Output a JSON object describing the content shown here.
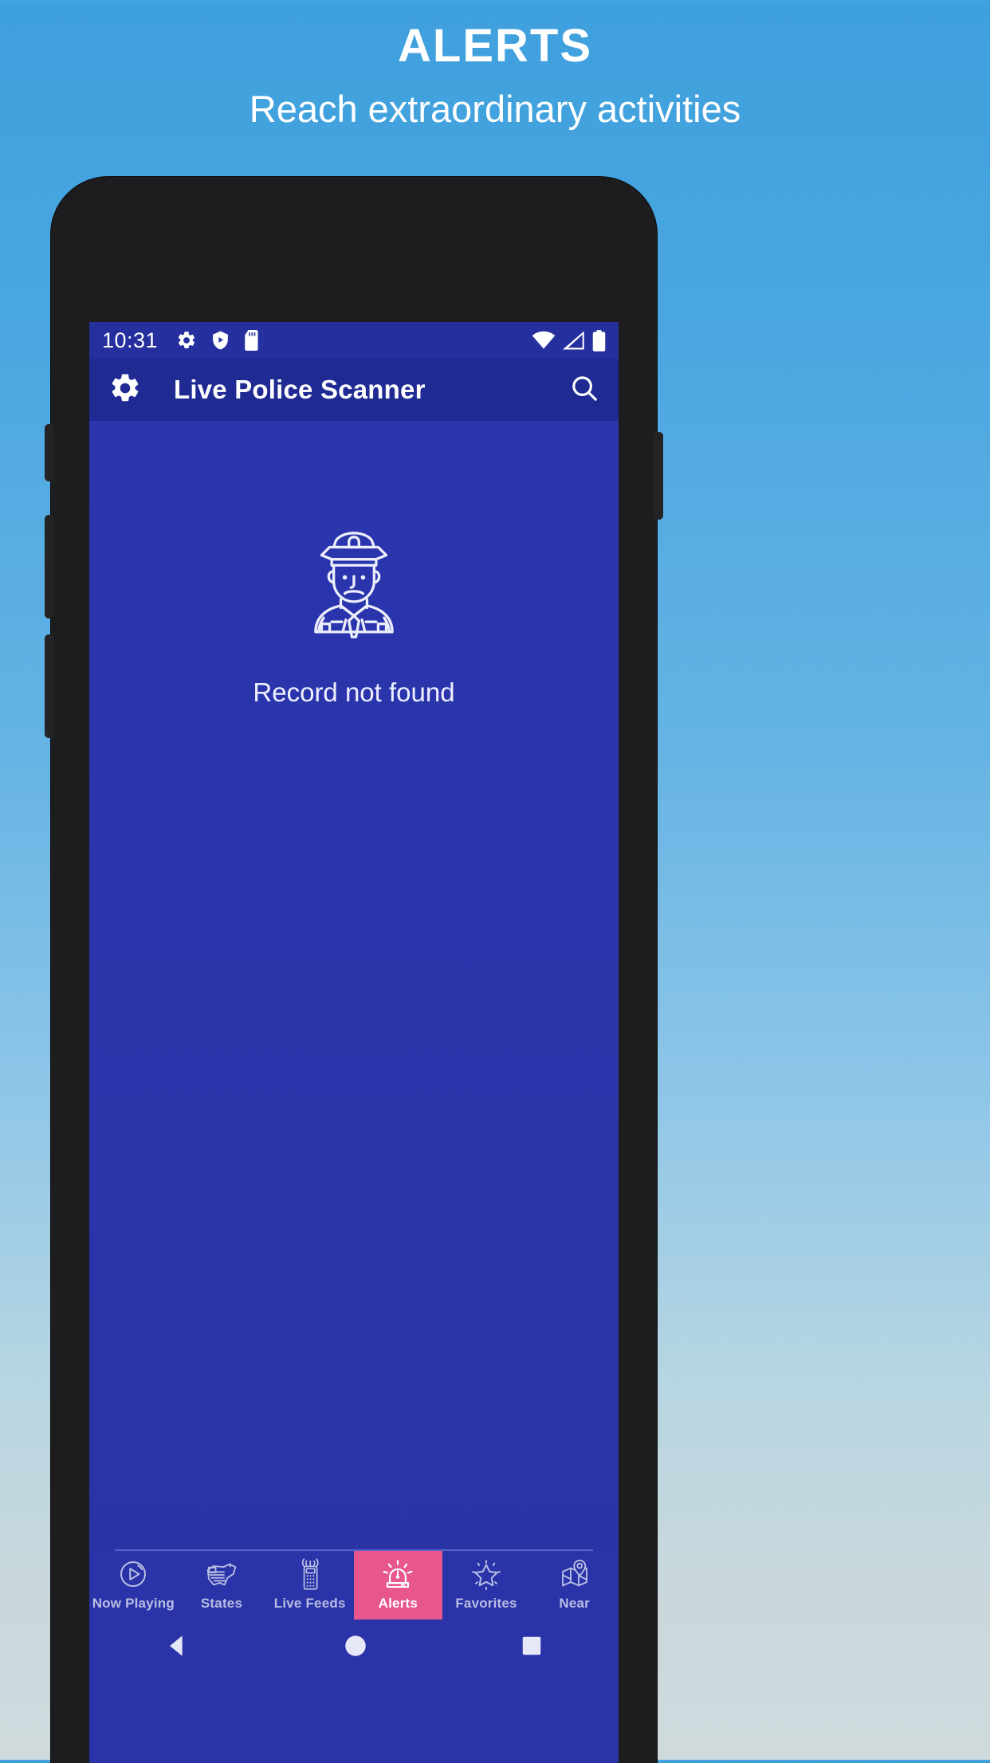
{
  "promo": {
    "title": "ALERTS",
    "subtitle": "Reach extraordinary activities",
    "background_top_color": "#3ea0dd",
    "background_bottom_color": "#d0dadd"
  },
  "phone": {
    "status_bar": {
      "time": "10:31",
      "left_icons": [
        "gear-icon",
        "play-protect-shield-icon",
        "sd-card-icon"
      ],
      "right_icons": [
        "wifi-icon",
        "cell-signal-icon",
        "battery-icon"
      ],
      "background_color": "#252f9e"
    },
    "app_bar": {
      "settings_icon": "gear-icon",
      "title": "Live Police Scanner",
      "search_icon": "search-icon",
      "background_color": "#1f2a93"
    },
    "content": {
      "illustration": "police-officer-icon",
      "empty_message": "Record not found",
      "background_color": "#2a35ae"
    },
    "bottom_nav": {
      "active_color": "#e8568e",
      "inactive_color": "#b9bfe3",
      "items": [
        {
          "label": "Now Playing",
          "icon": "play-circle-icon",
          "active": false
        },
        {
          "label": "States",
          "icon": "usa-map-flag-icon",
          "active": false
        },
        {
          "label": "Live Feeds",
          "icon": "walkie-talkie-icon",
          "active": false
        },
        {
          "label": "Alerts",
          "icon": "siren-icon",
          "active": true
        },
        {
          "label": "Favorites",
          "icon": "star-icon",
          "active": false
        },
        {
          "label": "Near",
          "icon": "map-pin-icon",
          "active": false
        }
      ]
    },
    "system_nav": {
      "back": "back-triangle-icon",
      "home": "home-circle-icon",
      "recents": "recents-square-icon"
    }
  }
}
